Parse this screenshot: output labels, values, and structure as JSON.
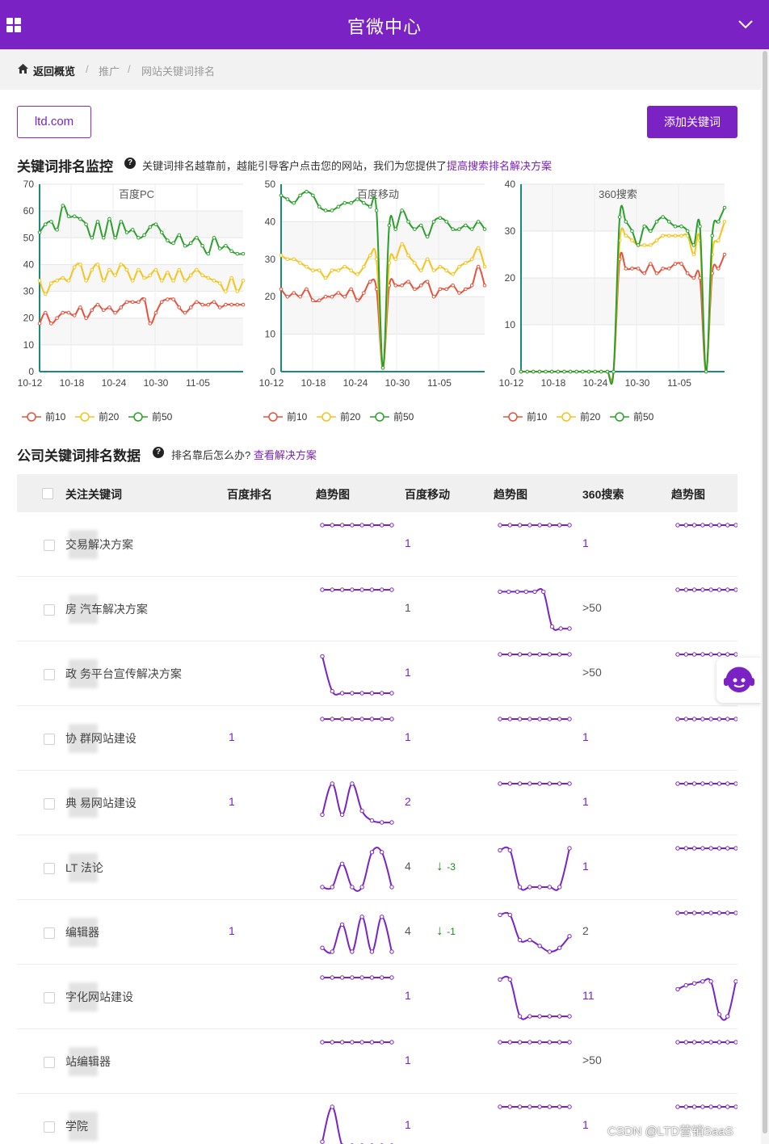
{
  "app": {
    "title": "官微中心"
  },
  "breadcrumb": {
    "items": [
      "返回概览",
      "推广",
      "网站关键词排名"
    ]
  },
  "toolbar": {
    "domain": "ltd.com",
    "add_label": "添加关键词"
  },
  "monitor": {
    "title": "关键词排名监控",
    "desc": "关键词排名越靠前，越能引导客户点击您的网站，我们为您提供了",
    "link": "提高搜索排名解决方案"
  },
  "table_section": {
    "title": "公司关键词排名数据",
    "desc": "排名靠后怎么办?",
    "link": "查看解决方案"
  },
  "legend": [
    "前10",
    "前20",
    "前50"
  ],
  "colors": {
    "accent": "#7b22c4",
    "top10": "#e8503a",
    "top20": "#f5c31a",
    "top50": "#2aa02a",
    "axis": "#1a8a7a"
  },
  "chart_data": [
    {
      "type": "line",
      "title": "百度PC",
      "x_ticks": [
        "10-12",
        "10-18",
        "10-24",
        "10-30",
        "11-05"
      ],
      "ylim": [
        0,
        70
      ],
      "y_ticks": [
        0,
        10,
        20,
        30,
        40,
        50,
        60,
        70
      ],
      "grid": true,
      "legend_position": "bottom-left",
      "series": [
        {
          "name": "前10",
          "values": [
            18,
            22,
            18,
            20,
            22,
            22,
            21,
            24,
            20,
            23,
            25,
            23,
            24,
            22,
            24,
            26,
            26,
            26,
            27,
            18,
            22,
            26,
            27,
            27,
            24,
            22,
            24,
            26,
            25,
            25,
            26,
            24,
            25,
            25,
            25,
            25
          ]
        },
        {
          "name": "前20",
          "values": [
            34,
            29,
            33,
            34,
            35,
            34,
            39,
            40,
            34,
            38,
            40,
            34,
            38,
            36,
            40,
            38,
            34,
            38,
            35,
            36,
            38,
            34,
            37,
            34,
            38,
            34,
            36,
            38,
            36,
            35,
            34,
            33,
            30,
            35,
            30,
            34
          ]
        },
        {
          "name": "前50",
          "values": [
            52,
            55,
            56,
            53,
            62,
            58,
            58,
            57,
            55,
            50,
            56,
            50,
            57,
            50,
            56,
            52,
            53,
            50,
            51,
            54,
            55,
            52,
            49,
            48,
            51,
            47,
            48,
            50,
            47,
            44,
            50,
            46,
            47,
            45,
            44,
            44
          ]
        }
      ]
    },
    {
      "type": "line",
      "title": "百度移动",
      "x_ticks": [
        "10-12",
        "10-18",
        "10-24",
        "10-30",
        "11-05"
      ],
      "ylim": [
        0,
        50
      ],
      "y_ticks": [
        0,
        10,
        20,
        30,
        40,
        50
      ],
      "grid": true,
      "legend_position": "bottom-left",
      "series": [
        {
          "name": "前10",
          "values": [
            22,
            20,
            21,
            20,
            22,
            19,
            19,
            20,
            20,
            21,
            20,
            22,
            19,
            21,
            24,
            22,
            1,
            23,
            23,
            23,
            24,
            22,
            23,
            24,
            20,
            22,
            22,
            23,
            21,
            22,
            23,
            28,
            23
          ]
        },
        {
          "name": "前20",
          "values": [
            31,
            30,
            30,
            29,
            28,
            27,
            27,
            25,
            27,
            27,
            28,
            27,
            26,
            28,
            31,
            30,
            1,
            29,
            30,
            34,
            31,
            29,
            27,
            30,
            27,
            28,
            27,
            26,
            28,
            29,
            30,
            33,
            28
          ]
        },
        {
          "name": "前50",
          "values": [
            47,
            46,
            45,
            47,
            48,
            47,
            44,
            43,
            43,
            44,
            45,
            45,
            46,
            45,
            44,
            43,
            1,
            39,
            38,
            43,
            40,
            38,
            39,
            36,
            40,
            41,
            40,
            38,
            38,
            39,
            38,
            40,
            38
          ]
        }
      ]
    },
    {
      "type": "line",
      "title": "360搜索",
      "x_ticks": [
        "10-12",
        "10-18",
        "10-24",
        "10-30",
        "11-05"
      ],
      "ylim": [
        0,
        40
      ],
      "y_ticks": [
        0,
        10,
        20,
        30,
        40
      ],
      "grid": true,
      "legend_position": "bottom-left",
      "series": [
        {
          "name": "前10",
          "values": [
            0,
            0,
            0,
            0,
            0,
            0,
            0,
            0,
            0,
            0,
            0,
            0,
            0,
            0,
            0,
            0,
            24,
            22,
            22,
            22,
            21,
            23,
            21,
            22,
            22,
            23,
            23,
            21,
            20,
            20,
            0,
            21,
            22,
            25
          ]
        },
        {
          "name": "前20",
          "values": [
            0,
            0,
            0,
            0,
            0,
            0,
            0,
            0,
            0,
            0,
            0,
            0,
            0,
            0,
            0,
            0,
            28,
            29,
            28,
            27,
            27,
            27,
            28,
            29,
            29,
            29,
            29,
            29,
            25,
            28,
            0,
            25,
            28,
            32
          ]
        },
        {
          "name": "前50",
          "values": [
            0,
            0,
            0,
            0,
            0,
            0,
            0,
            0,
            0,
            0,
            0,
            0,
            0,
            0,
            0,
            0,
            33,
            32,
            30,
            27,
            31,
            30,
            32,
            33,
            32,
            31,
            31,
            30,
            27,
            31,
            0,
            29,
            32,
            35
          ]
        }
      ]
    }
  ],
  "table": {
    "headers": [
      "关注关键词",
      "百度排名",
      "趋势图",
      "百度移动",
      "趋势图",
      "360搜索",
      "趋势图"
    ],
    "rows": [
      {
        "keyword": "交易解决方案",
        "baidu": "",
        "trend1": [
          1,
          1,
          1,
          1,
          1,
          1,
          1,
          1
        ],
        "mobile": "1",
        "mobile_change": "",
        "trend2": [
          1,
          1,
          1,
          1,
          1,
          1,
          1,
          1
        ],
        "s360": "1",
        "trend3": [
          1,
          1,
          1,
          1,
          1,
          1,
          1,
          1
        ]
      },
      {
        "keyword": "房  汽车解决方案",
        "baidu": "",
        "trend1": [
          1,
          1,
          1,
          1,
          1,
          1,
          1,
          1
        ],
        "mobile": "1",
        "mobile_change": "",
        "trend2": [
          0.95,
          0.95,
          0.95,
          0.95,
          0.95,
          0.95,
          0.05,
          0,
          0
        ],
        "s360": ">50",
        "trend3": [
          1,
          1,
          1,
          1,
          1,
          1,
          1,
          1
        ]
      },
      {
        "keyword": "政  务平台宣传解决方案",
        "baidu": "",
        "trend1": [
          0.95,
          0.05,
          0,
          0,
          0,
          0,
          0,
          0
        ],
        "mobile": "1",
        "mobile_change": "",
        "trend2": [
          1,
          1,
          1,
          1,
          1,
          1,
          1,
          1
        ],
        "s360": ">50",
        "trend3": [
          1,
          1,
          1,
          1,
          1,
          1,
          1,
          1
        ]
      },
      {
        "keyword": "协  群网站建设",
        "baidu": "1",
        "trend1": [
          1,
          1,
          1,
          1,
          1,
          1,
          1,
          1
        ],
        "mobile": "1",
        "mobile_change": "",
        "trend2": [
          1,
          1,
          1,
          1,
          1,
          1,
          1,
          1
        ],
        "s360": "1",
        "trend3": [
          1,
          1,
          1,
          1,
          1,
          1,
          1,
          1
        ]
      },
      {
        "keyword": "典  易网站建设",
        "baidu": "1",
        "trend1": [
          0.2,
          1,
          0.2,
          1,
          0.3,
          0.05,
          0,
          0
        ],
        "mobile": "2",
        "mobile_change": "",
        "trend2": [
          1,
          1,
          1,
          1,
          1,
          1,
          1,
          1
        ],
        "s360": "1",
        "trend3": [
          1,
          1,
          1,
          1,
          1,
          1,
          1,
          1
        ]
      },
      {
        "keyword": "LT  法论",
        "baidu": "",
        "trend1": [
          0,
          0,
          0.6,
          0,
          0,
          0.9,
          0.9,
          0
        ],
        "mobile": "4",
        "mobile_change": "-3",
        "trend2": [
          0.95,
          0.95,
          0,
          0,
          0,
          0,
          0,
          1
        ],
        "s360": "1",
        "trend3": [
          1,
          1,
          1,
          1,
          1,
          1,
          1,
          1
        ]
      },
      {
        "keyword": "  编辑器",
        "baidu": "1",
        "trend1": [
          0.1,
          0,
          0.7,
          0,
          0.9,
          0,
          0.9,
          0
        ],
        "mobile": "4",
        "mobile_change": "-1",
        "trend2": [
          0.95,
          0.95,
          0.3,
          0.3,
          0.15,
          0,
          0.1,
          0.4
        ],
        "s360": "2",
        "trend3": [
          1,
          1,
          1,
          1,
          1,
          1,
          1,
          1
        ]
      },
      {
        "keyword": "字化网站建设",
        "baidu": "",
        "trend1": [
          1,
          1,
          1,
          1,
          1,
          1,
          1,
          1
        ],
        "mobile": "1",
        "mobile_change": "",
        "trend2": [
          0.95,
          0.95,
          0,
          0,
          0,
          0,
          0,
          0
        ],
        "s360": "11",
        "trend3": [
          0.7,
          0.8,
          0.85,
          0.9,
          0.9,
          0.05,
          0,
          0.9
        ]
      },
      {
        "keyword": "站编辑器",
        "baidu": "",
        "trend1": [
          1,
          1,
          1,
          1,
          1,
          1,
          1,
          1
        ],
        "mobile": "1",
        "mobile_change": "",
        "trend2": [
          1,
          1,
          1,
          1,
          1,
          1,
          1,
          1
        ],
        "s360": ">50",
        "trend3": [
          1,
          1,
          1,
          1,
          1,
          1,
          1,
          1
        ]
      },
      {
        "keyword": "学院",
        "baidu": "",
        "trend1": [
          0.1,
          1,
          0,
          0,
          0,
          0,
          0,
          0
        ],
        "mobile": "1",
        "mobile_change": "",
        "trend2": [
          1,
          1,
          1,
          1,
          1,
          1,
          1,
          1
        ],
        "s360": "1",
        "trend3": [
          1,
          1,
          1,
          1,
          1,
          1,
          1,
          1
        ]
      }
    ]
  },
  "watermark": "CSDN @LTD营销SaaS"
}
